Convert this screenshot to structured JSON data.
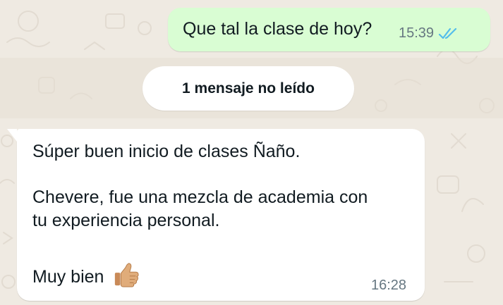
{
  "chat": {
    "outgoing": {
      "text": "Que tal la clase de hoy?",
      "time": "15:39",
      "status_icon": "double-check-read-icon"
    },
    "unread_divider": {
      "label": "1 mensaje no leído"
    },
    "incoming": {
      "line1": "Súper buen inicio de clases Ñaño.",
      "line2": "Chevere, fue una mezcla de academia con",
      "line3": "tu experiencia personal.",
      "line4": "Muy bien",
      "emoji": "thumbs-up-icon",
      "time": "16:28"
    }
  },
  "colors": {
    "background": "#efeae2",
    "outgoing_bubble": "#d9fdd3",
    "incoming_bubble": "#ffffff",
    "read_ticks": "#53bdeb",
    "timestamp": "#667781"
  }
}
